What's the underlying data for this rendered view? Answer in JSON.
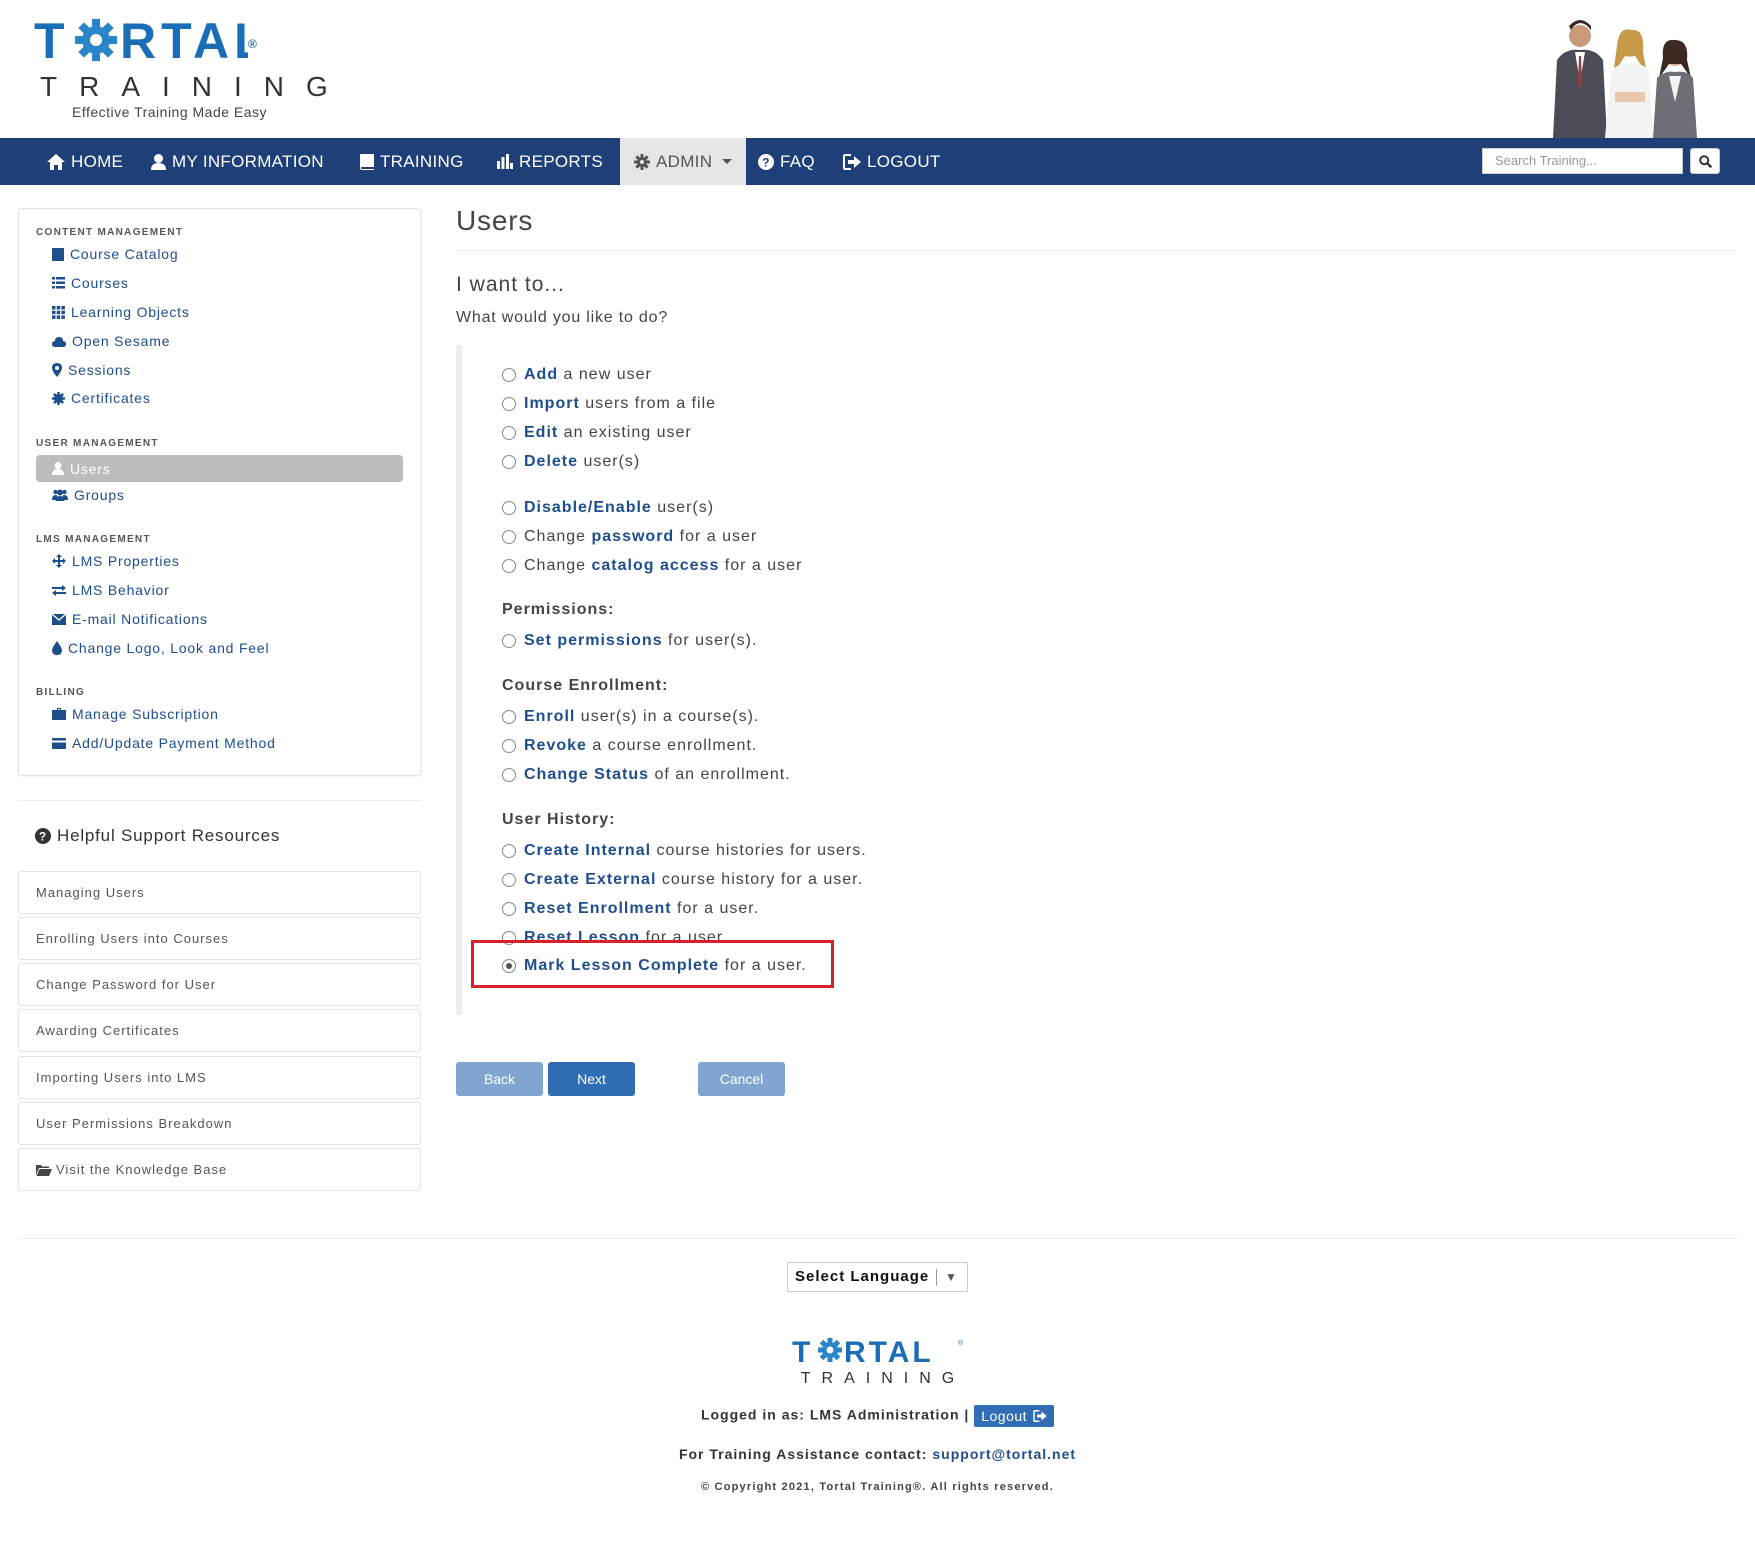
{
  "brand": {
    "logo_word": "TORTAL",
    "logo_sub": "TRAINING",
    "tagline": "Effective Training Made Easy"
  },
  "nav": {
    "items": [
      {
        "label": "HOME",
        "icon": "home-icon"
      },
      {
        "label": "MY INFORMATION",
        "icon": "user-icon"
      },
      {
        "label": "TRAINING",
        "icon": "book-icon"
      },
      {
        "label": "REPORTS",
        "icon": "bar-chart-icon"
      },
      {
        "label": "ADMIN",
        "icon": "gear-icon"
      },
      {
        "label": "FAQ",
        "icon": "question-circle-icon"
      },
      {
        "label": "LOGOUT",
        "icon": "logout-icon"
      }
    ],
    "search_placeholder": "Search Training..."
  },
  "sidebar": {
    "content_management": {
      "heading": "CONTENT MANAGEMENT",
      "items": [
        "Course Catalog",
        "Courses",
        "Learning Objects",
        "Open Sesame",
        "Sessions",
        "Certificates"
      ]
    },
    "user_management": {
      "heading": "USER MANAGEMENT",
      "items": [
        "Users",
        "Groups"
      ]
    },
    "lms_management": {
      "heading": "LMS MANAGEMENT",
      "items": [
        "LMS Properties",
        "LMS Behavior",
        "E-mail Notifications",
        "Change Logo, Look and Feel"
      ]
    },
    "billing": {
      "heading": "BILLING",
      "items": [
        "Manage Subscription",
        "Add/Update Payment Method"
      ]
    }
  },
  "support": {
    "title": "Helpful Support Resources",
    "items": [
      "Managing Users",
      "Enrolling Users into Courses",
      "Change Password for User",
      "Awarding Certificates",
      "Importing Users into LMS",
      "User Permissions Breakdown",
      "Visit the Knowledge Base"
    ]
  },
  "main": {
    "title": "Users",
    "subtitle": "I want to...",
    "question": "What would you like to do?",
    "options": [
      {
        "pre": "",
        "bold": "Add",
        "post": " a new user",
        "checked": false
      },
      {
        "pre": "",
        "bold": "Import",
        "post": " users from a file",
        "checked": false
      },
      {
        "pre": "",
        "bold": "Edit",
        "post": " an existing user",
        "checked": false
      },
      {
        "pre": "",
        "bold": "Delete",
        "post": " user(s)",
        "checked": false
      },
      {
        "pre": "",
        "bold": "Disable/Enable",
        "post": " user(s)",
        "checked": false
      },
      {
        "pre": "Change ",
        "bold": "password",
        "post": " for a user",
        "checked": false
      },
      {
        "pre": "Change ",
        "bold": "catalog access",
        "post": " for a user",
        "checked": false
      },
      {
        "pre": "",
        "bold": "Set permissions",
        "post": " for user(s).",
        "checked": false
      },
      {
        "pre": "",
        "bold": "Enroll",
        "post": " user(s) in a course(s).",
        "checked": false
      },
      {
        "pre": "",
        "bold": "Revoke",
        "post": " a course enrollment.",
        "checked": false
      },
      {
        "pre": "",
        "bold": "Change Status",
        "post": " of an enrollment.",
        "checked": false
      },
      {
        "pre": "",
        "bold": "Create Internal",
        "post": " course histories for users.",
        "checked": false
      },
      {
        "pre": "",
        "bold": "Create External",
        "post": " course history for a user.",
        "checked": false
      },
      {
        "pre": "",
        "bold": "Reset Enrollment",
        "post": " for a user.",
        "checked": false
      },
      {
        "pre": "",
        "bold": "Reset Lesson",
        "post": " for a user.",
        "checked": false
      },
      {
        "pre": "",
        "bold": "Mark Lesson Complete",
        "post": " for a user.",
        "checked": true
      }
    ],
    "sections": {
      "permissions": "Permissions:",
      "enrollment": "Course Enrollment:",
      "history": "User History:"
    },
    "buttons": {
      "back": "Back",
      "next": "Next",
      "cancel": "Cancel"
    }
  },
  "footer": {
    "language": "Select Language",
    "logged_in": "Logged in as: LMS Administration |",
    "logout": "Logout",
    "contact_label": "For Training Assistance contact:",
    "contact_email": "support@tortal.net",
    "copyright": "© Copyright 2021, Tortal Training®. All rights reserved."
  },
  "colors": {
    "nav_bg": "#1e3f77",
    "link": "#1e4e8c",
    "brand": "#1a6eb5",
    "highlight_box": "#d6202a"
  }
}
